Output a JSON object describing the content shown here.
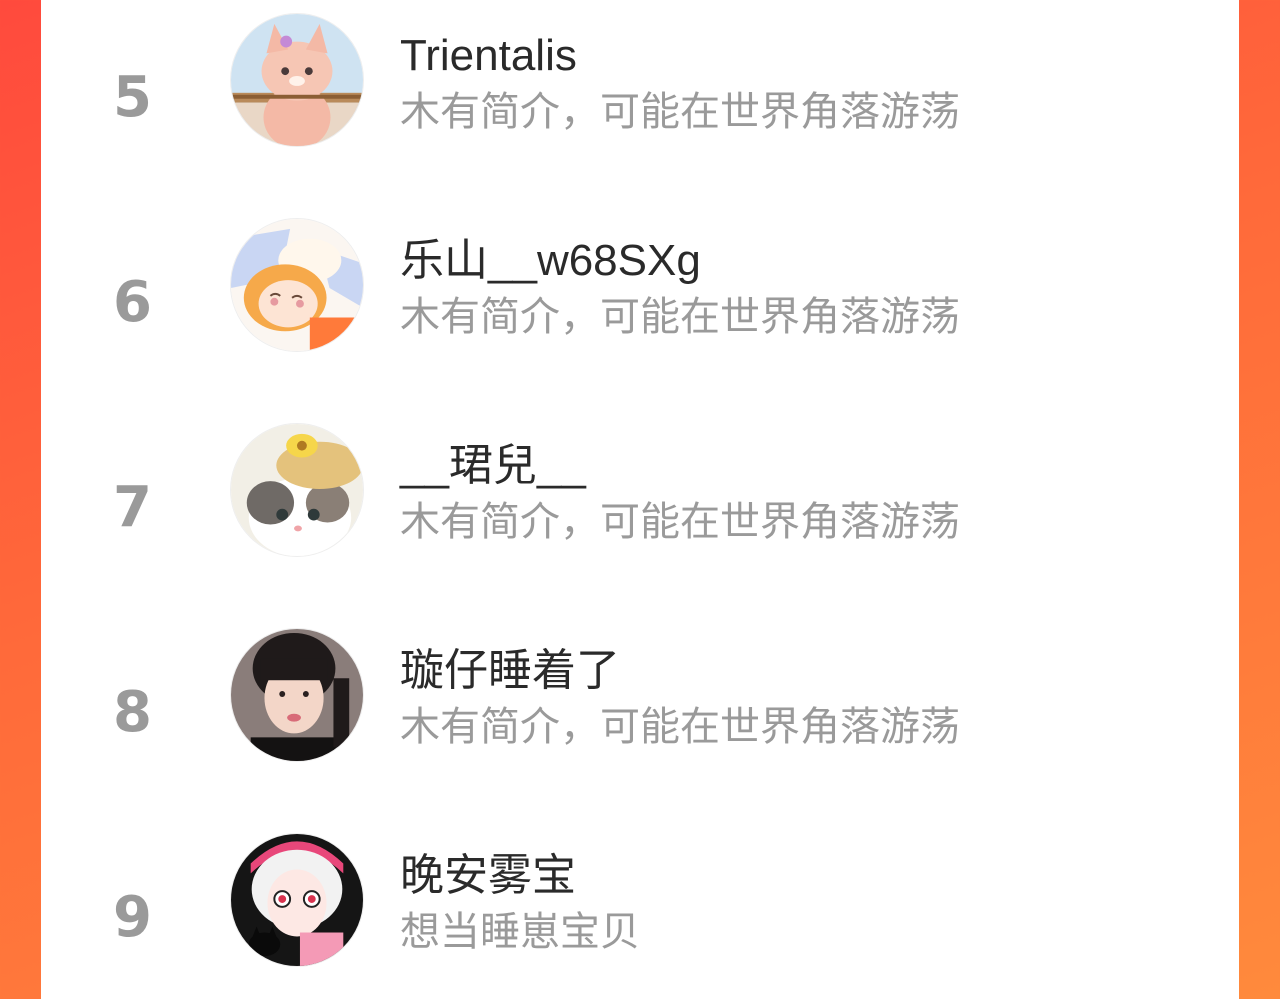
{
  "ranking": {
    "items": [
      {
        "rank": "5",
        "name": "Trientalis",
        "bio": "木有简介，可能在世界角落游荡",
        "avatar": "plush-fox-avatar"
      },
      {
        "rank": "6",
        "name": "乐山__w68SXg",
        "bio": "木有简介，可能在世界角落游荡",
        "avatar": "anime-girl-sleeping-avatar"
      },
      {
        "rank": "7",
        "name": "__珺兒__",
        "bio": "木有简介，可能在世界角落游荡",
        "avatar": "cat-with-straw-hat-avatar"
      },
      {
        "rank": "8",
        "name": "璇仔睡着了",
        "bio": "木有简介，可能在世界角落游荡",
        "avatar": "girl-portrait-avatar"
      },
      {
        "rank": "9",
        "name": "晚安雾宝",
        "bio": "想当睡崽宝贝",
        "avatar": "anime-girl-cat-avatar"
      }
    ]
  },
  "colors": {
    "background_gradient_start": "#ff4a3d",
    "background_gradient_end": "#ff8a3c",
    "panel": "#ffffff",
    "rank_text": "#9a9a9a",
    "name_text": "#2a2a2a",
    "bio_text": "#9a9a9a"
  }
}
